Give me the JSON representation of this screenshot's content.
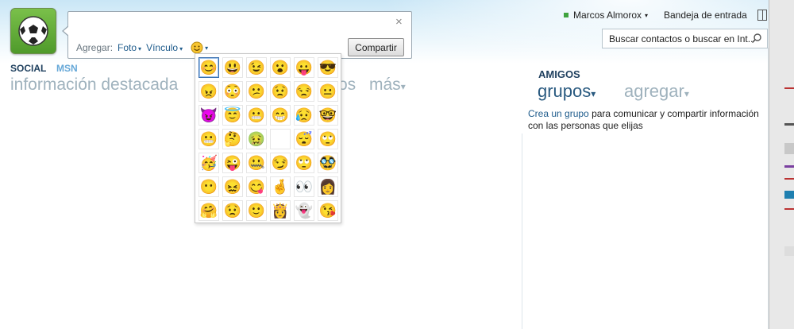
{
  "composer": {
    "agregar_label": "Agregar:",
    "foto_label": "Foto",
    "vinculo_label": "Vínculo",
    "share_label": "Compartir",
    "close_glyph": "×",
    "dropdown_glyph": "▾"
  },
  "sections": {
    "social": "SOCIAL",
    "msn": "MSN",
    "highlights": "información destacada",
    "partial_tab": "os",
    "more": "más"
  },
  "header": {
    "user_name": "Marcos Almorox",
    "inbox_label": "Bandeja de entrada",
    "status_color": "#3fa33f"
  },
  "search": {
    "placeholder": "Buscar contactos o buscar en Int..."
  },
  "friends": {
    "heading": "AMIGOS",
    "groups_tab": "grupos",
    "add_tab": "agregar",
    "create_group_link": "Crea un grupo",
    "create_group_text": "para comunicar y compartir información con las personas que elijas"
  },
  "emoticons": [
    [
      "😊",
      "😃",
      "😉",
      "😮",
      "😛",
      "😎"
    ],
    [
      "😠",
      "😳",
      "😕",
      "😟",
      "😒",
      "😐"
    ],
    [
      "😈",
      "😇",
      "😬",
      "😁",
      "😥",
      "🤓"
    ],
    [
      "😬",
      "🤔",
      "🤢",
      "",
      "😴",
      "🙄"
    ],
    [
      "🥳",
      "😜",
      "🤐",
      "😏",
      "🙄",
      "🥸"
    ],
    [
      "😶",
      "😖",
      "😋",
      "🤞",
      "👀",
      "👩"
    ],
    [
      "🤗",
      "😟",
      "🙂",
      "👸",
      "👻",
      "😘"
    ]
  ],
  "accent": "#1f5c8c"
}
